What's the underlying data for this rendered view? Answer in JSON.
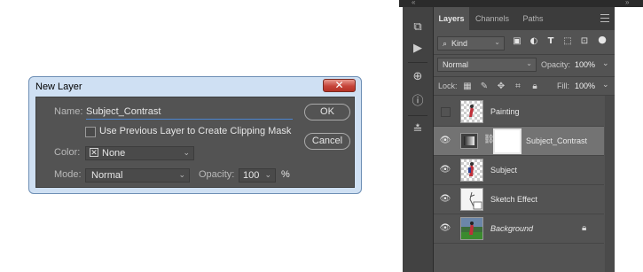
{
  "dialog": {
    "title": "New Layer",
    "close_label": "✕",
    "name_label": "Name:",
    "name_value": "Subject_Contrast",
    "ok_label": "OK",
    "cancel_label": "Cancel",
    "clipping_mask_label": "Use Previous Layer to Create Clipping Mask",
    "color_label": "Color:",
    "color_value": "None",
    "mode_label": "Mode:",
    "mode_value": "Normal",
    "opacity_label": "Opacity:",
    "opacity_value": "100",
    "opacity_unit": "%"
  },
  "panel": {
    "tabs": [
      "Layers",
      "Channels",
      "Paths"
    ],
    "filter_value": "Kind",
    "blend_mode": "Normal",
    "opacity_label": "Opacity:",
    "opacity_value": "100%",
    "lock_label": "Lock:",
    "fill_label": "Fill:",
    "fill_value": "100%",
    "layers": [
      {
        "name": "Painting",
        "visible": false,
        "icon": "painting-thumb"
      },
      {
        "name": "Subject_Contrast",
        "visible": true,
        "selected": true,
        "icon": "levels-adjustment"
      },
      {
        "name": "Subject",
        "visible": true,
        "icon": "subject-thumb"
      },
      {
        "name": "Sketch Effect",
        "visible": true,
        "icon": "sketch-thumb"
      },
      {
        "name": "Background",
        "visible": true,
        "locked": true,
        "icon": "photo-thumb"
      }
    ]
  },
  "colors": {
    "panel_bg": "#535353",
    "dialog_bg": "#535353",
    "selected_row": "#737373",
    "accent_underline": "#4b85d1"
  }
}
